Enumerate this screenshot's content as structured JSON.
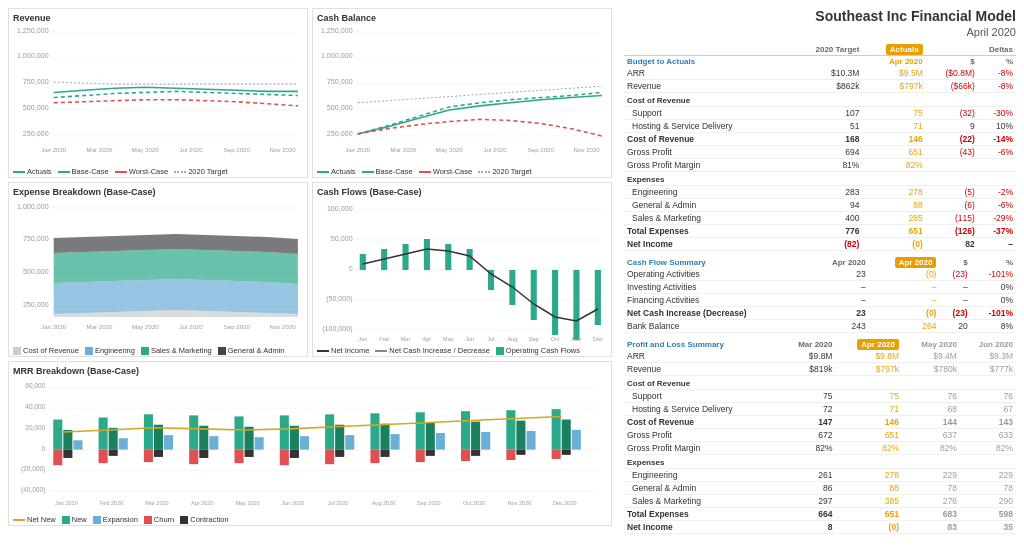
{
  "title": "Southeast Inc Financial Model",
  "subtitle": "April 2020",
  "charts": {
    "revenue": {
      "title": "Revenue",
      "yLabels": [
        "1,250,000",
        "1,000,000",
        "750,000",
        "500,000",
        "250,000"
      ],
      "xLabels": [
        "Jan 2020",
        "Mar 2020",
        "May 2020",
        "Jul 2020",
        "Sep 2020",
        "Nov 2020"
      ]
    },
    "cashBalance": {
      "title": "Cash Balance",
      "yLabels": [
        "1,250,000",
        "1,000,000",
        "750,000",
        "500,000",
        "250,000"
      ],
      "xLabels": [
        "Jan 2020",
        "Mar 2020",
        "May 2020",
        "Jul 2020",
        "Sep 2020",
        "Nov 2020"
      ]
    },
    "expenseBreakdown": {
      "title": "Expense Breakdown (Base-Case)",
      "yLabels": [
        "1,000,000",
        "750,000",
        "500,000",
        "250,000"
      ],
      "xLabels": [
        "Jan 2020",
        "Mar 2020",
        "May 2020",
        "Jul 2020",
        "Sep 2020",
        "Nov 2020"
      ]
    },
    "cashFlows": {
      "title": "Cash Flows (Base-Case)",
      "yLabels": [
        "100,000",
        "50,000",
        "0",
        "(50,000)",
        "(100,000)"
      ],
      "xLabels": [
        "Jan",
        "Feb",
        "Mar",
        "Apr",
        "May",
        "Jun",
        "Jul",
        "Aug",
        "Sep",
        "Oct",
        "Nov",
        "Dec"
      ]
    },
    "mrrBreakdown": {
      "title": "MRR Breakdown (Base-Case)",
      "yLabels": [
        "60,000",
        "40,000",
        "20,000",
        "0",
        "(20,000)",
        "(40,000)"
      ],
      "xLabels": [
        "Jan 2020",
        "Feb 2020",
        "Mar 2020",
        "Apr 2020",
        "May 2020",
        "Jun 2020",
        "Jul 2020",
        "Aug 2020",
        "Sep 2020",
        "Oct 2020",
        "Nov 2020",
        "Dec 2020"
      ]
    }
  },
  "budgetToActuals": {
    "sectionLabel": "Budget to Actuals",
    "col1": "2020 Target",
    "col2": "Actuals",
    "col2sub": "Apr 2020",
    "col3": "Deltas",
    "col3dollar": "$",
    "col3pct": "%",
    "rows": [
      {
        "label": "ARR",
        "target": "$10.3M",
        "actual": "$9.5M",
        "deltaD": "($0.8M)",
        "deltaPct": "-8%",
        "bold": false
      },
      {
        "label": "Revenue",
        "target": "$862k",
        "actual": "$797k",
        "deltaD": "($66k)",
        "deltaPct": "-8%",
        "bold": false
      },
      {
        "label": "Cost of Revenue",
        "target": "",
        "actual": "",
        "deltaD": "",
        "deltaPct": "",
        "bold": false,
        "section": true
      },
      {
        "label": "Support",
        "target": "107",
        "actual": "75",
        "deltaD": "(32)",
        "deltaPct": "-30%",
        "bold": false
      },
      {
        "label": "Hosting & Service Delivery",
        "target": "51",
        "actual": "71",
        "deltaD": "9",
        "deltaPct": "10%",
        "bold": false
      },
      {
        "label": "Cost of Revenue",
        "target": "168",
        "actual": "146",
        "deltaD": "(22)",
        "deltaPct": "-14%",
        "bold": true
      },
      {
        "label": "Gross Profit",
        "target": "694",
        "actual": "651",
        "deltaD": "(43)",
        "deltaPct": "-6%",
        "bold": false
      },
      {
        "label": "Gross Profit Margin",
        "target": "81%",
        "actual": "82%",
        "deltaD": "",
        "deltaPct": "",
        "bold": false
      },
      {
        "label": "Expenses",
        "target": "",
        "actual": "",
        "deltaD": "",
        "deltaPct": "",
        "bold": false,
        "section": true
      },
      {
        "label": "Engineering",
        "target": "283",
        "actual": "278",
        "deltaD": "(5)",
        "deltaPct": "-2%",
        "bold": false
      },
      {
        "label": "General & Admin",
        "target": "94",
        "actual": "88",
        "deltaD": "(6)",
        "deltaPct": "-6%",
        "bold": false
      },
      {
        "label": "Sales & Marketing",
        "target": "400",
        "actual": "285",
        "deltaD": "(115)",
        "deltaPct": "-29%",
        "bold": false
      },
      {
        "label": "Total Expenses",
        "target": "776",
        "actual": "651",
        "deltaD": "(126)",
        "deltaPct": "-37%",
        "bold": true
      },
      {
        "label": "Net Income",
        "target": "(82)",
        "actual": "(0)",
        "deltaD": "82",
        "deltaPct": "–",
        "bold": true
      }
    ]
  },
  "cashFlowSummary": {
    "sectionLabel": "Cash Flow Summary",
    "col1": "Apr 2020",
    "col2": "Apr 2020",
    "col3": "$",
    "col4": "%",
    "rows": [
      {
        "label": "Operating Activities",
        "c1": "23",
        "c2": "(0)",
        "c3": "(23)",
        "c4": "-101%",
        "bold": false
      },
      {
        "label": "Investing Activities",
        "c1": "–",
        "c2": "–",
        "c3": "–",
        "c4": "0%",
        "bold": false
      },
      {
        "label": "Financing Activities",
        "c1": "–",
        "c2": "–",
        "c3": "–",
        "c4": "0%",
        "bold": false
      },
      {
        "label": "Net Cash Increase (Decrease)",
        "c1": "23",
        "c2": "(0)",
        "c3": "(23)",
        "c4": "-101%",
        "bold": true
      }
    ],
    "bankBalance": {
      "label": "Bank Balance",
      "c1": "243",
      "c2": "264",
      "c3": "20",
      "c4": "8%"
    }
  },
  "plSummary": {
    "sectionLabel": "Profit and Loss Summary",
    "col1": "Mar 2020",
    "col2": "Apr 2020",
    "col3": "May 2020",
    "col4": "Jun 2020",
    "rows": [
      {
        "label": "ARR",
        "c1": "$9.8M",
        "c2": "$9.8M",
        "c3": "$9.4M",
        "c4": "$9.3M",
        "bold": false
      },
      {
        "label": "Revenue",
        "c1": "$819k",
        "c2": "$797k",
        "c3": "$780k",
        "c4": "$777k",
        "bold": false
      },
      {
        "label": "Cost of Revenue",
        "target": "",
        "actual": "",
        "deltaD": "",
        "deltaPct": "",
        "bold": false,
        "section": true
      },
      {
        "label": "Support",
        "c1": "75",
        "c2": "75",
        "c3": "76",
        "c4": "76",
        "bold": false
      },
      {
        "label": "Hosting & Service Delivery",
        "c1": "72",
        "c2": "71",
        "c3": "68",
        "c4": "67",
        "bold": false
      },
      {
        "label": "Cost of Revenue",
        "c1": "147",
        "c2": "146",
        "c3": "144",
        "c4": "143",
        "bold": true
      },
      {
        "label": "Gross Profit",
        "c1": "672",
        "c2": "651",
        "c3": "637",
        "c4": "633",
        "bold": false
      },
      {
        "label": "Gross Profit Margin",
        "c1": "82%",
        "c2": "82%",
        "c3": "82%",
        "c4": "82%",
        "bold": false
      },
      {
        "label": "Expenses",
        "c1": "",
        "c2": "",
        "c3": "",
        "c4": "",
        "bold": false,
        "section": true
      },
      {
        "label": "Engineering",
        "c1": "261",
        "c2": "278",
        "c3": "229",
        "c4": "229",
        "bold": false
      },
      {
        "label": "General & Admin",
        "c1": "86",
        "c2": "88",
        "c3": "78",
        "c4": "78",
        "bold": false
      },
      {
        "label": "Sales & Marketing",
        "c1": "297",
        "c2": "385",
        "c3": "276",
        "c4": "290",
        "bold": false
      },
      {
        "label": "Total Expenses",
        "c1": "664",
        "c2": "651",
        "c3": "683",
        "c4": "598",
        "bold": true
      },
      {
        "label": "Net Income",
        "c1": "8",
        "c2": "(0)",
        "c3": "83",
        "c4": "35",
        "bold": true
      }
    ]
  }
}
